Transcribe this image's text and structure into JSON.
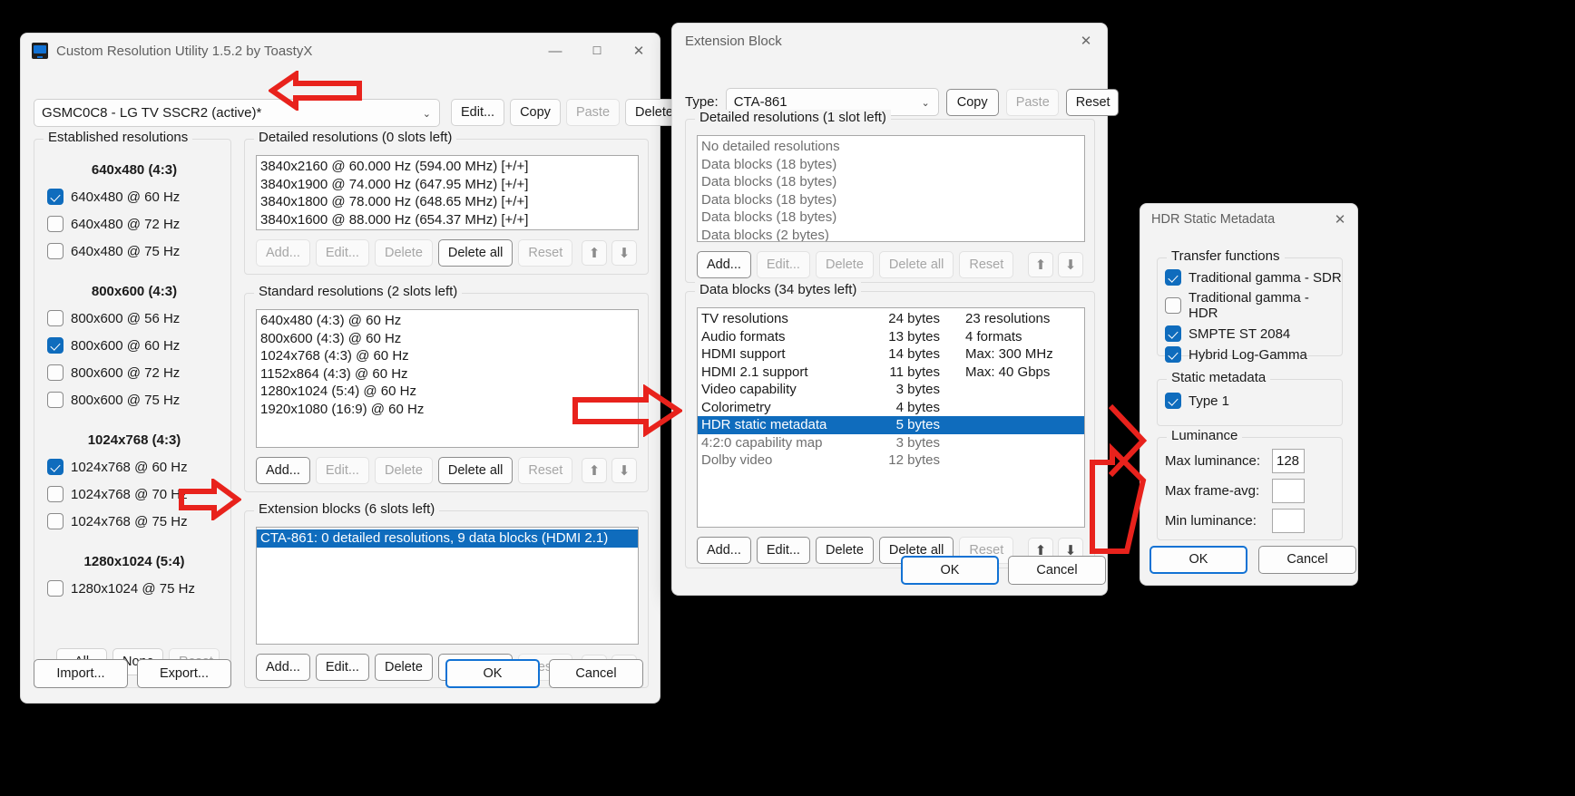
{
  "main_window": {
    "title": "Custom Resolution Utility 1.5.2 by ToastyX",
    "caption": {
      "minimize": "—",
      "maximize": "❐",
      "close": "✕"
    },
    "display_combo": {
      "value": "GSMC0C8 - LG TV SSCR2 (active)*",
      "chevron": "⌄"
    },
    "top_buttons": [
      {
        "label": "Edit...",
        "disabled": false
      },
      {
        "label": "Copy",
        "disabled": false
      },
      {
        "label": "Paste",
        "disabled": true
      },
      {
        "label": "Delete",
        "disabled": false
      }
    ],
    "established": {
      "legend": "Established resolutions",
      "groups": [
        {
          "header": "640x480 (4:3)",
          "items": [
            {
              "label": "640x480 @ 60 Hz",
              "checked": true
            },
            {
              "label": "640x480 @ 72 Hz",
              "checked": false
            },
            {
              "label": "640x480 @ 75 Hz",
              "checked": false
            }
          ]
        },
        {
          "header": "800x600 (4:3)",
          "items": [
            {
              "label": "800x600 @ 56 Hz",
              "checked": false
            },
            {
              "label": "800x600 @ 60 Hz",
              "checked": true
            },
            {
              "label": "800x600 @ 72 Hz",
              "checked": false
            },
            {
              "label": "800x600 @ 75 Hz",
              "checked": false
            }
          ]
        },
        {
          "header": "1024x768 (4:3)",
          "items": [
            {
              "label": "1024x768 @ 60 Hz",
              "checked": true
            },
            {
              "label": "1024x768 @ 70 Hz",
              "checked": false
            },
            {
              "label": "1024x768 @ 75 Hz",
              "checked": false
            }
          ]
        },
        {
          "header": "1280x1024 (5:4)",
          "items": [
            {
              "label": "1280x1024 @ 75 Hz",
              "checked": false
            }
          ]
        }
      ],
      "buttons": [
        {
          "label": "All",
          "disabled": false
        },
        {
          "label": "None",
          "disabled": false
        },
        {
          "label": "Reset",
          "disabled": true
        }
      ]
    },
    "detailed": {
      "legend": "Detailed resolutions (0 slots left)",
      "rows": [
        "3840x2160 @ 60.000 Hz (594.00 MHz) [+/+]",
        "3840x1900 @ 74.000 Hz (647.95 MHz) [+/+]",
        "3840x1800 @ 78.000 Hz (648.65 MHz) [+/+]",
        "3840x1600 @ 88.000 Hz (654.37 MHz) [+/+]"
      ],
      "buttons": [
        {
          "label": "Add...",
          "disabled": true
        },
        {
          "label": "Edit...",
          "disabled": true
        },
        {
          "label": "Delete",
          "disabled": true
        },
        {
          "label": "Delete all",
          "disabled": false
        },
        {
          "label": "Reset",
          "disabled": true
        }
      ],
      "up_icon": "⬆",
      "down_icon": "⬇"
    },
    "standard": {
      "legend": "Standard resolutions (2 slots left)",
      "rows": [
        "640x480 (4:3) @ 60 Hz",
        "800x600 (4:3) @ 60 Hz",
        "1024x768 (4:3) @ 60 Hz",
        "1152x864 (4:3) @ 60 Hz",
        "1280x1024 (5:4) @ 60 Hz",
        "1920x1080 (16:9) @ 60 Hz"
      ],
      "buttons": [
        {
          "label": "Add...",
          "disabled": false
        },
        {
          "label": "Edit...",
          "disabled": true
        },
        {
          "label": "Delete",
          "disabled": true
        },
        {
          "label": "Delete all",
          "disabled": false
        },
        {
          "label": "Reset",
          "disabled": true
        }
      ],
      "up_icon": "⬆",
      "down_icon": "⬇"
    },
    "extension_blocks": {
      "legend": "Extension blocks (6 slots left)",
      "rows": [
        {
          "label": "CTA-861: 0 detailed resolutions, 9 data blocks (HDMI 2.1)",
          "selected": true
        }
      ],
      "buttons": [
        {
          "label": "Add...",
          "disabled": false
        },
        {
          "label": "Edit...",
          "disabled": false
        },
        {
          "label": "Delete",
          "disabled": false
        },
        {
          "label": "Delete all",
          "disabled": false
        },
        {
          "label": "Reset",
          "disabled": true
        }
      ],
      "up_icon": "⬆",
      "down_icon": "⬇"
    },
    "footer": {
      "import": "Import...",
      "export": "Export...",
      "ok": "OK",
      "cancel": "Cancel"
    }
  },
  "extension_window": {
    "title": "Extension Block",
    "close": "✕",
    "type_label": "Type:",
    "type_value": "CTA-861",
    "type_chevron": "⌄",
    "header_buttons": [
      {
        "label": "Copy",
        "disabled": false
      },
      {
        "label": "Paste",
        "disabled": true
      },
      {
        "label": "Reset",
        "disabled": false
      }
    ],
    "detailed": {
      "legend": "Detailed resolutions (1 slot left)",
      "rows": [
        "No detailed resolutions",
        "Data blocks (18 bytes)",
        "Data blocks (18 bytes)",
        "Data blocks (18 bytes)",
        "Data blocks (18 bytes)",
        "Data blocks (2 bytes)"
      ],
      "buttons": [
        {
          "label": "Add...",
          "disabled": false
        },
        {
          "label": "Edit...",
          "disabled": true
        },
        {
          "label": "Delete",
          "disabled": true
        },
        {
          "label": "Delete all",
          "disabled": true
        },
        {
          "label": "Reset",
          "disabled": true
        }
      ],
      "up_icon": "⬆",
      "down_icon": "⬇"
    },
    "data_blocks": {
      "legend": "Data blocks (34 bytes left)",
      "rows": [
        {
          "name": "TV resolutions",
          "size": "24 bytes",
          "info": "23 resolutions",
          "selected": false,
          "dim": false
        },
        {
          "name": "Audio formats",
          "size": "13 bytes",
          "info": "4 formats",
          "selected": false,
          "dim": false
        },
        {
          "name": "HDMI support",
          "size": "14 bytes",
          "info": "Max: 300 MHz",
          "selected": false,
          "dim": false
        },
        {
          "name": "HDMI 2.1 support",
          "size": "11 bytes",
          "info": "Max: 40 Gbps",
          "selected": false,
          "dim": false
        },
        {
          "name": "Video capability",
          "size": "3 bytes",
          "info": "",
          "selected": false,
          "dim": false
        },
        {
          "name": "Colorimetry",
          "size": "4 bytes",
          "info": "",
          "selected": false,
          "dim": false
        },
        {
          "name": "HDR static metadata",
          "size": "5 bytes",
          "info": "",
          "selected": true,
          "dim": false
        },
        {
          "name": "4:2:0 capability map",
          "size": "3 bytes",
          "info": "",
          "selected": false,
          "dim": true
        },
        {
          "name": "Dolby video",
          "size": "12 bytes",
          "info": "",
          "selected": false,
          "dim": true
        }
      ],
      "buttons": [
        {
          "label": "Add...",
          "disabled": false
        },
        {
          "label": "Edit...",
          "disabled": false
        },
        {
          "label": "Delete",
          "disabled": false
        },
        {
          "label": "Delete all",
          "disabled": false
        },
        {
          "label": "Reset",
          "disabled": true
        }
      ],
      "up_icon": "⬆",
      "down_icon": "⬇"
    },
    "footer": {
      "ok": "OK",
      "cancel": "Cancel"
    }
  },
  "hdr_window": {
    "title": "HDR Static Metadata",
    "close": "✕",
    "transfer": {
      "legend": "Transfer functions",
      "items": [
        {
          "label": "Traditional gamma - SDR",
          "checked": true
        },
        {
          "label": "Traditional gamma - HDR",
          "checked": false
        },
        {
          "label": "SMPTE ST 2084",
          "checked": true
        },
        {
          "label": "Hybrid Log-Gamma",
          "checked": true
        }
      ]
    },
    "static_metadata": {
      "legend": "Static metadata",
      "items": [
        {
          "label": "Type 1",
          "checked": true
        }
      ]
    },
    "luminance": {
      "legend": "Luminance",
      "fields": [
        {
          "label": "Max luminance:",
          "value": "128"
        },
        {
          "label": "Max frame-avg:",
          "value": ""
        },
        {
          "label": "Min luminance:",
          "value": ""
        }
      ]
    },
    "footer": {
      "ok": "OK",
      "cancel": "Cancel"
    }
  },
  "annotations": {
    "accent_selection": "#0f6cbd",
    "arrow_color": "#e8221c",
    "arrows": [
      {
        "name": "arrow-to-display-combo",
        "direction": "left"
      },
      {
        "name": "arrow-to-extension-block-row",
        "direction": "right"
      },
      {
        "name": "arrow-to-data-blocks-list",
        "direction": "right"
      },
      {
        "name": "arrow-to-hdr-dialog",
        "direction": "right"
      }
    ]
  }
}
